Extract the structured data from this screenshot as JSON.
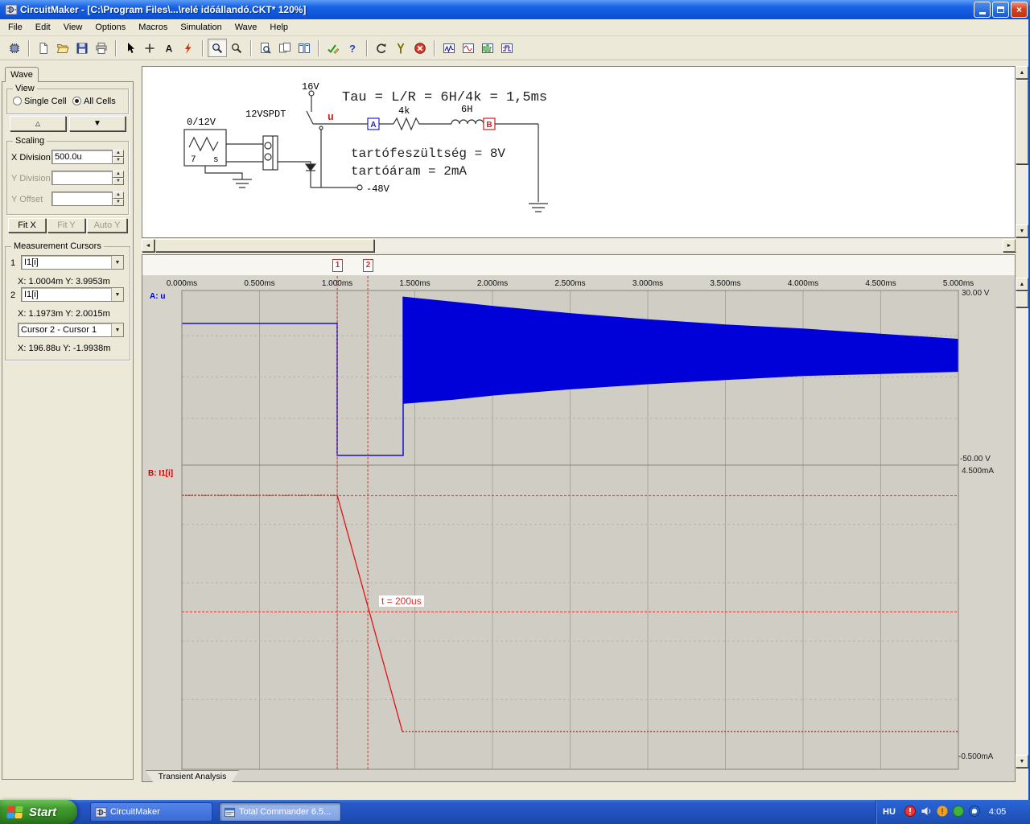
{
  "window": {
    "title": "CircuitMaker - [C:\\Program Files\\...\\relé időállandó.CKT* 120%]",
    "controls": [
      "minimize-icon",
      "maximize-icon",
      "close-icon"
    ]
  },
  "menu": {
    "items": [
      "File",
      "Edit",
      "View",
      "Options",
      "Macros",
      "Simulation",
      "Wave",
      "Help"
    ]
  },
  "toolbar": {
    "groups": [
      [
        "parts-browser"
      ],
      [
        "new-file",
        "open-file",
        "save",
        "print"
      ],
      [
        "select-tool",
        "wire-tool",
        "text-tool",
        "delete-tool"
      ],
      [
        "zoom-window",
        "zoom"
      ],
      [
        "fit-page",
        "view-pages",
        "tile-windows"
      ],
      [
        "check-circuit",
        "help"
      ],
      [
        "reset-simulation",
        "probe-tool",
        "stop-simulation"
      ],
      [
        "waveform-window-1",
        "waveform-window-2",
        "waveform-window-3",
        "waveform-window-4"
      ]
    ],
    "pressed": [
      "zoom-window"
    ]
  },
  "sidebar": {
    "tab": "Wave",
    "view_group": "View",
    "radio_single": "Single Cell",
    "radio_all": "All Cells",
    "btn_up": "△",
    "btn_down": "▼",
    "scaling_group": "Scaling",
    "x_division_label": "X Division",
    "x_division_value": "500.0u",
    "y_division_label": "Y Division",
    "y_division_value": "",
    "y_offset_label": "Y Offset",
    "y_offset_value": "",
    "fit_x": "Fit X",
    "fit_y": "Fit Y",
    "auto_y": "Auto Y",
    "cursors_group": "Measurement Cursors",
    "cursor1_index": "1",
    "cursor1_signal": "I1[i]",
    "cursor1_readout": "X: 1.0004m Y: 3.9953m",
    "cursor2_index": "2",
    "cursor2_signal": "I1[i]",
    "cursor2_readout": "X: 1.1973m Y: 2.0015m",
    "diff_selector": "Cursor 2 - Cursor 1",
    "diff_readout": "X: 196.88u Y: -1.9938m"
  },
  "schematic": {
    "supply_label": "16V",
    "source_label": "0/12V",
    "source_inner_left": "7",
    "source_inner_right": "s",
    "relay_label": "12VSPDT",
    "node_label": "u",
    "probe_a": "A",
    "probe_b": "B",
    "resistor_label": "4k",
    "inductor_label": "6H",
    "neg_supply_label": "-48V",
    "note_tau": "Tau = L/R = 6H/4k = 1,5ms",
    "note_hold_voltage": "tartófeszültség = 8V",
    "note_hold_current": "tartóáram = 2mA"
  },
  "waveform": {
    "x_ticks": [
      "0.000ms",
      "0.500ms",
      "1.000ms",
      "1.500ms",
      "2.000ms",
      "2.500ms",
      "3.000ms",
      "3.500ms",
      "4.000ms",
      "4.500ms",
      "5.000ms"
    ],
    "channel_a_label": "A: u",
    "channel_b_label": "B: I1[i]",
    "a_max_label": "30.00 V",
    "a_min_label": "-50.00 V",
    "b_max_label": "4.500mA",
    "b_min_label": "-0.500mA",
    "cursor1_flag": "1",
    "cursor2_flag": "2",
    "cursors": {
      "c1": {
        "t_ms": 1.0004,
        "y_ma": 3.9953
      },
      "c2": {
        "t_ms": 1.1973,
        "y_ma": 2.0015
      }
    },
    "annotation": {
      "text": "t = 200us",
      "x_ms": 1.27,
      "y_ma": 2.16
    },
    "tab_label": "Transient Analysis"
  },
  "chart_data": [
    {
      "type": "line",
      "name": "A: u",
      "y_unit": "V",
      "x_unit": "ms",
      "color": "#0000d8",
      "xlim": [
        0,
        5
      ],
      "ylim": [
        -50,
        30
      ],
      "points": [
        [
          0,
          16
        ],
        [
          1.0,
          16
        ],
        [
          1.0,
          -48
        ],
        [
          1.425,
          -48
        ],
        [
          1.425,
          29
        ]
      ],
      "oscillation_envelope": {
        "x": [
          1.425,
          1.75,
          2.0,
          2.5,
          3.0,
          3.5,
          4.0,
          4.5,
          5.0
        ],
        "top": [
          29,
          26.5,
          24.5,
          21,
          18,
          15.5,
          13.5,
          11,
          8.5
        ],
        "bottom": [
          -23,
          -21,
          -19,
          -16,
          -13.5,
          -11.5,
          -9.5,
          -8.5,
          -7.5
        ]
      }
    },
    {
      "type": "line",
      "name": "B: I1[i]",
      "y_unit": "mA",
      "x_unit": "ms",
      "color": "#dd1414",
      "xlim": [
        0,
        5
      ],
      "ylim": [
        -0.5,
        4.5
      ],
      "points": [
        [
          0,
          4.0
        ],
        [
          1.0,
          4.0
        ],
        [
          1.42,
          -0.05
        ],
        [
          5.0,
          -0.05
        ]
      ]
    }
  ],
  "taskbar": {
    "start_label": "Start",
    "tasks": [
      {
        "label": "CircuitMaker",
        "icon": "circuitmaker-icon",
        "active": false
      },
      {
        "label": "Total Commander 6.5...",
        "icon": "total-commander-icon",
        "active": true
      }
    ],
    "tray_icons": [
      "antivirus-icon",
      "volume-icon",
      "alert-icon",
      "status-icon",
      "messenger-icon"
    ],
    "language": "HU",
    "time": "4:05"
  }
}
